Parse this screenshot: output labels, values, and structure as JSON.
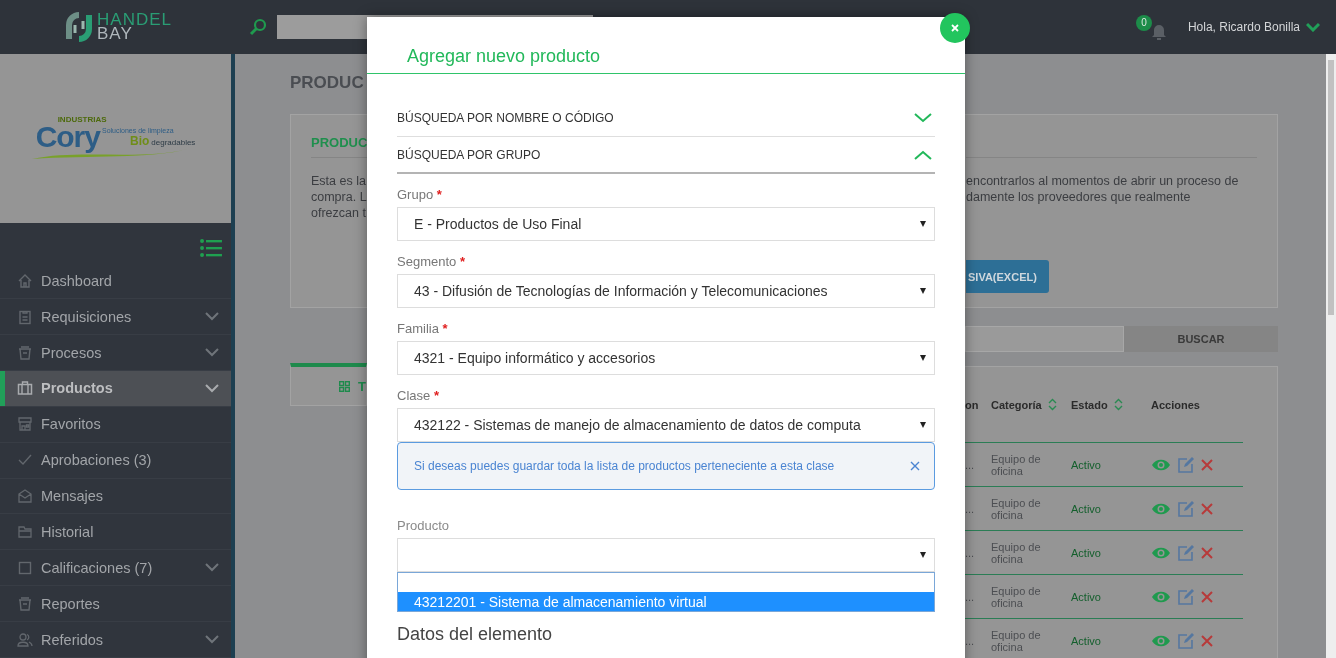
{
  "header": {
    "logo": {
      "line_1": "HANDEL",
      "line_2": "BAY"
    },
    "notifications": "0",
    "greeting": "Hola, Ricardo Bonilla"
  },
  "company_logo": {
    "kicker": "INDUSTRIAS",
    "name": "Cory",
    "tagline": "Soluciones de limpieza",
    "highlight": "Bio",
    "tail": "degradables"
  },
  "sidebar": {
    "items": [
      {
        "label": "Dashboard",
        "selected": false,
        "expandable": false
      },
      {
        "label": "Requisiciones",
        "selected": false,
        "expandable": true
      },
      {
        "label": "Procesos",
        "selected": false,
        "expandable": true
      },
      {
        "label": "Productos",
        "selected": true,
        "expandable": true
      },
      {
        "label": "Favoritos",
        "selected": false,
        "expandable": false
      },
      {
        "label": "Aprobaciones (3)",
        "selected": false,
        "expandable": false
      },
      {
        "label": "Mensajes",
        "selected": false,
        "expandable": false
      },
      {
        "label": "Historial",
        "selected": false,
        "expandable": false
      },
      {
        "label": "Calificaciones (7)",
        "selected": false,
        "expandable": true
      },
      {
        "label": "Reportes",
        "selected": false,
        "expandable": false
      },
      {
        "label": "Referidos",
        "selected": false,
        "expandable": true
      }
    ]
  },
  "page": {
    "title": "PRODUC",
    "intro_card": {
      "heading": "PRODUC",
      "text_left": [
        "Esta es la",
        "compra. L",
        "ofrezcan t"
      ],
      "text_right": [
        "encontrarlos al momentos de abrir un proceso de",
        "damente los proveedores que realmente"
      ],
      "upload_button": "SIVA(EXCEL)"
    },
    "search": {
      "button": "BUSCAR"
    },
    "tabs": [
      {
        "label": "T",
        "selected": true
      }
    ],
    "table": {
      "columns": [
        {
          "label": "on",
          "sortable": false
        },
        {
          "label": "Categoría",
          "sortable": true
        },
        {
          "label": "Estado",
          "sortable": true
        },
        {
          "label": "Acciones",
          "sortable": false
        }
      ],
      "rows": [
        {
          "column_1": "...",
          "category": "Equipo de oficina",
          "status": "Activo"
        },
        {
          "column_1": "...",
          "category": "Equipo de oficina",
          "status": "Activo"
        },
        {
          "column_1": "...",
          "category": "Equipo de oficina",
          "status": "Activo"
        },
        {
          "column_1": "...",
          "category": "Equipo de oficina",
          "status": "Activo"
        },
        {
          "column_1": "...",
          "category": "Equipo de oficina",
          "status": "Activo"
        }
      ]
    }
  },
  "modal": {
    "title": "Agregar nuevo producto",
    "sections": [
      {
        "label": "BÚSQUEDA POR NOMBRE O CÓDIGO",
        "expanded": false
      },
      {
        "label": "BÚSQUEDA POR GRUPO",
        "expanded": true
      }
    ],
    "fields": [
      {
        "label": "Grupo",
        "required_mark": "*",
        "value": "E - Productos de Uso Final"
      },
      {
        "label": "Segmento",
        "required_mark": "*",
        "value": "43 - Difusión de Tecnologías de Información y Telecomunicaciones"
      },
      {
        "label": "Familia",
        "required_mark": "*",
        "value": "4321 - Equipo informático y accesorios"
      },
      {
        "label": "Clase",
        "required_mark": "*",
        "value": "432122 - Sistemas de manejo de almacenamiento de datos de computa"
      }
    ],
    "alert": "Si deseas puedes guardar toda la lista de productos perteneciente a esta clase",
    "product_field": {
      "label": "Producto",
      "expanded": true,
      "options": [
        {
          "label": "43212201 - Sistema de almacenamiento virtual",
          "selected": true
        }
      ]
    },
    "section_title": "Datos del elemento"
  }
}
